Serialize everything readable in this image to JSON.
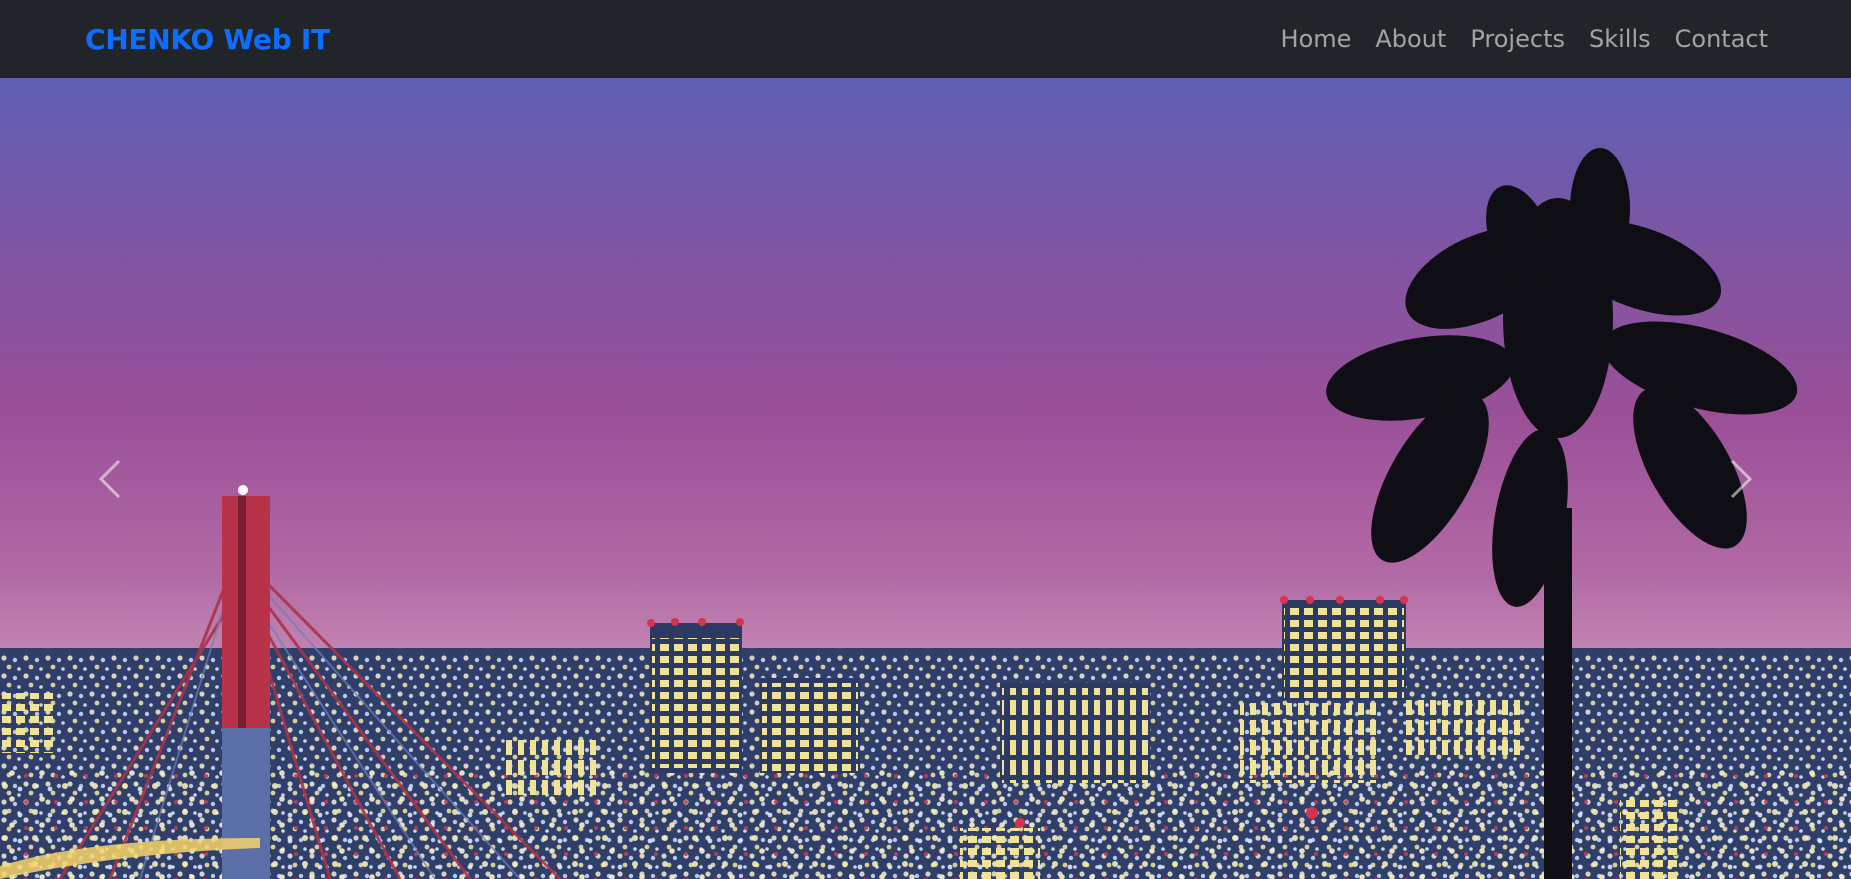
{
  "navbar": {
    "brand": "CHENKO Web IT",
    "links": [
      {
        "label": "Home"
      },
      {
        "label": "About"
      },
      {
        "label": "Projects"
      },
      {
        "label": "Skills"
      },
      {
        "label": "Contact"
      }
    ]
  },
  "carousel": {
    "prev_icon": "chevron-left-icon",
    "next_icon": "chevron-right-icon"
  },
  "colors": {
    "navbar_bg": "#212529",
    "brand": "#0d6efd",
    "nav_link": "#8f9194"
  }
}
